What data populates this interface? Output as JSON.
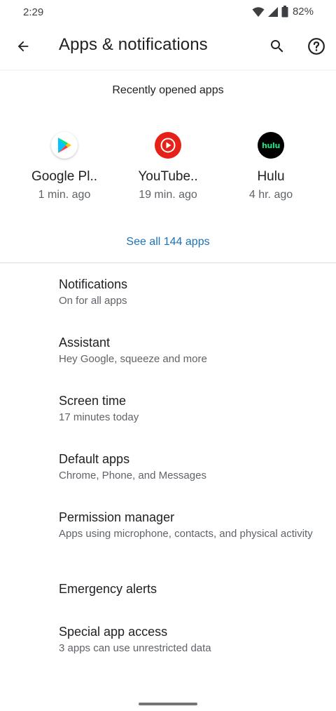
{
  "status_bar": {
    "time": "2:29",
    "battery": "82%"
  },
  "app_bar": {
    "title": "Apps & notifications",
    "back_icon": "arrow-back-icon",
    "search_icon": "search-icon",
    "help_icon": "help-circle-icon"
  },
  "recent": {
    "header": "Recently opened apps",
    "apps": [
      {
        "name": "Google Pl..",
        "time": "1 min. ago",
        "icon": "google-play-icon"
      },
      {
        "name": "YouTube..",
        "time": "19 min. ago",
        "icon": "youtube-music-icon"
      },
      {
        "name": "Hulu",
        "time": "4 hr. ago",
        "icon": "hulu-icon",
        "icon_text": "hulu"
      }
    ],
    "see_all": "See all 144 apps"
  },
  "settings": [
    {
      "title": "Notifications",
      "summary": "On for all apps"
    },
    {
      "title": "Assistant",
      "summary": "Hey Google, squeeze and more"
    },
    {
      "title": "Screen time",
      "summary": "17 minutes today"
    },
    {
      "title": "Default apps",
      "summary": "Chrome, Phone, and Messages"
    },
    {
      "title": "Permission manager",
      "summary": "Apps using microphone, contacts, and physical activity"
    },
    {
      "title": "Emergency alerts",
      "summary": ""
    },
    {
      "title": "Special app access",
      "summary": "3 apps can use unrestricted data"
    }
  ],
  "colors": {
    "accent": "#1b72b8",
    "youtube_red": "#e62117",
    "hulu_green": "#1ce783"
  }
}
